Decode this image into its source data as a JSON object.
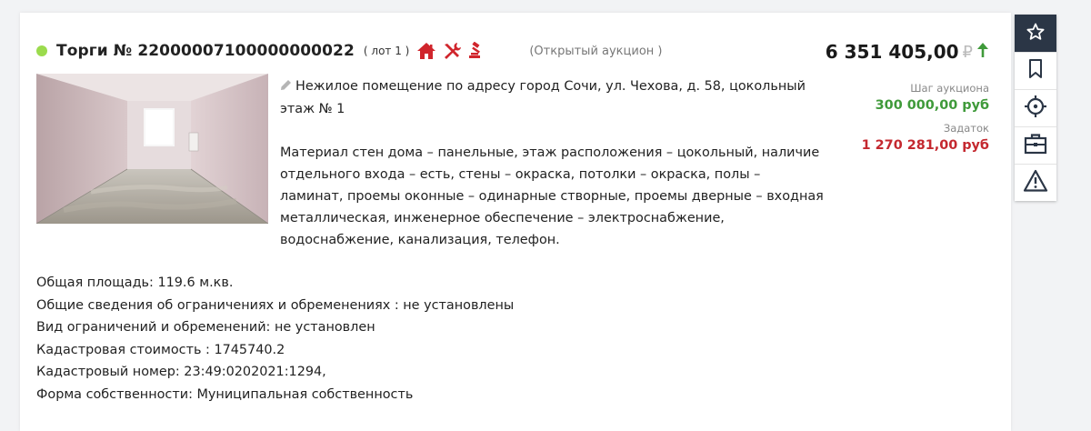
{
  "lot": {
    "title": "Торги № 22000007100000000022",
    "lot_label": "( лот 1 )",
    "auction_type": "(Открытый аукцион )",
    "status_color": "#9bdb4d",
    "icons": [
      "house-icon",
      "tools-icon",
      "gavel-icon"
    ]
  },
  "price": {
    "value": "6 351 405,00",
    "currency": "₽",
    "trend": "up"
  },
  "description": {
    "short": "Нежилое помещение по адресу город Сочи, ул. Чехова, д. 58, цокольный этаж № 1",
    "long": "Материал стен дома – панельные, этаж расположения – цокольный, наличие отдельного входа – есть, стены – окраска, потолки – окраска, полы – ламинат, проемы оконные – одинарные створные, проемы дверные – входная металлическая, инженерное обеспечение – электроснабжение, водоснабжение, канализация, телефон."
  },
  "side": {
    "step_label": "Шаг аукциона",
    "step_value": "300 000,00 руб",
    "deposit_label": "Задаток",
    "deposit_value": "1 270 281,00 руб"
  },
  "details": [
    "Общая площадь: 119.6 м.кв.",
    "Общие сведения об ограничениях и обременениях : не установлены",
    "Вид ограничений и обременений: не установлен",
    "Кадастровая стоимость : 1745740.2",
    "Кадастровый номер: 23:49:0202021:1294,",
    "Форма собственности: Муниципальная собственность"
  ],
  "toolbar": [
    "star-icon",
    "bookmark-icon",
    "crosshair-icon",
    "briefcase-icon",
    "warning-icon"
  ],
  "colors": {
    "accent_green": "#3f9a3a",
    "accent_red": "#c4282f",
    "toolbar_active": "#2b3646",
    "icon_red": "#d0252c"
  }
}
